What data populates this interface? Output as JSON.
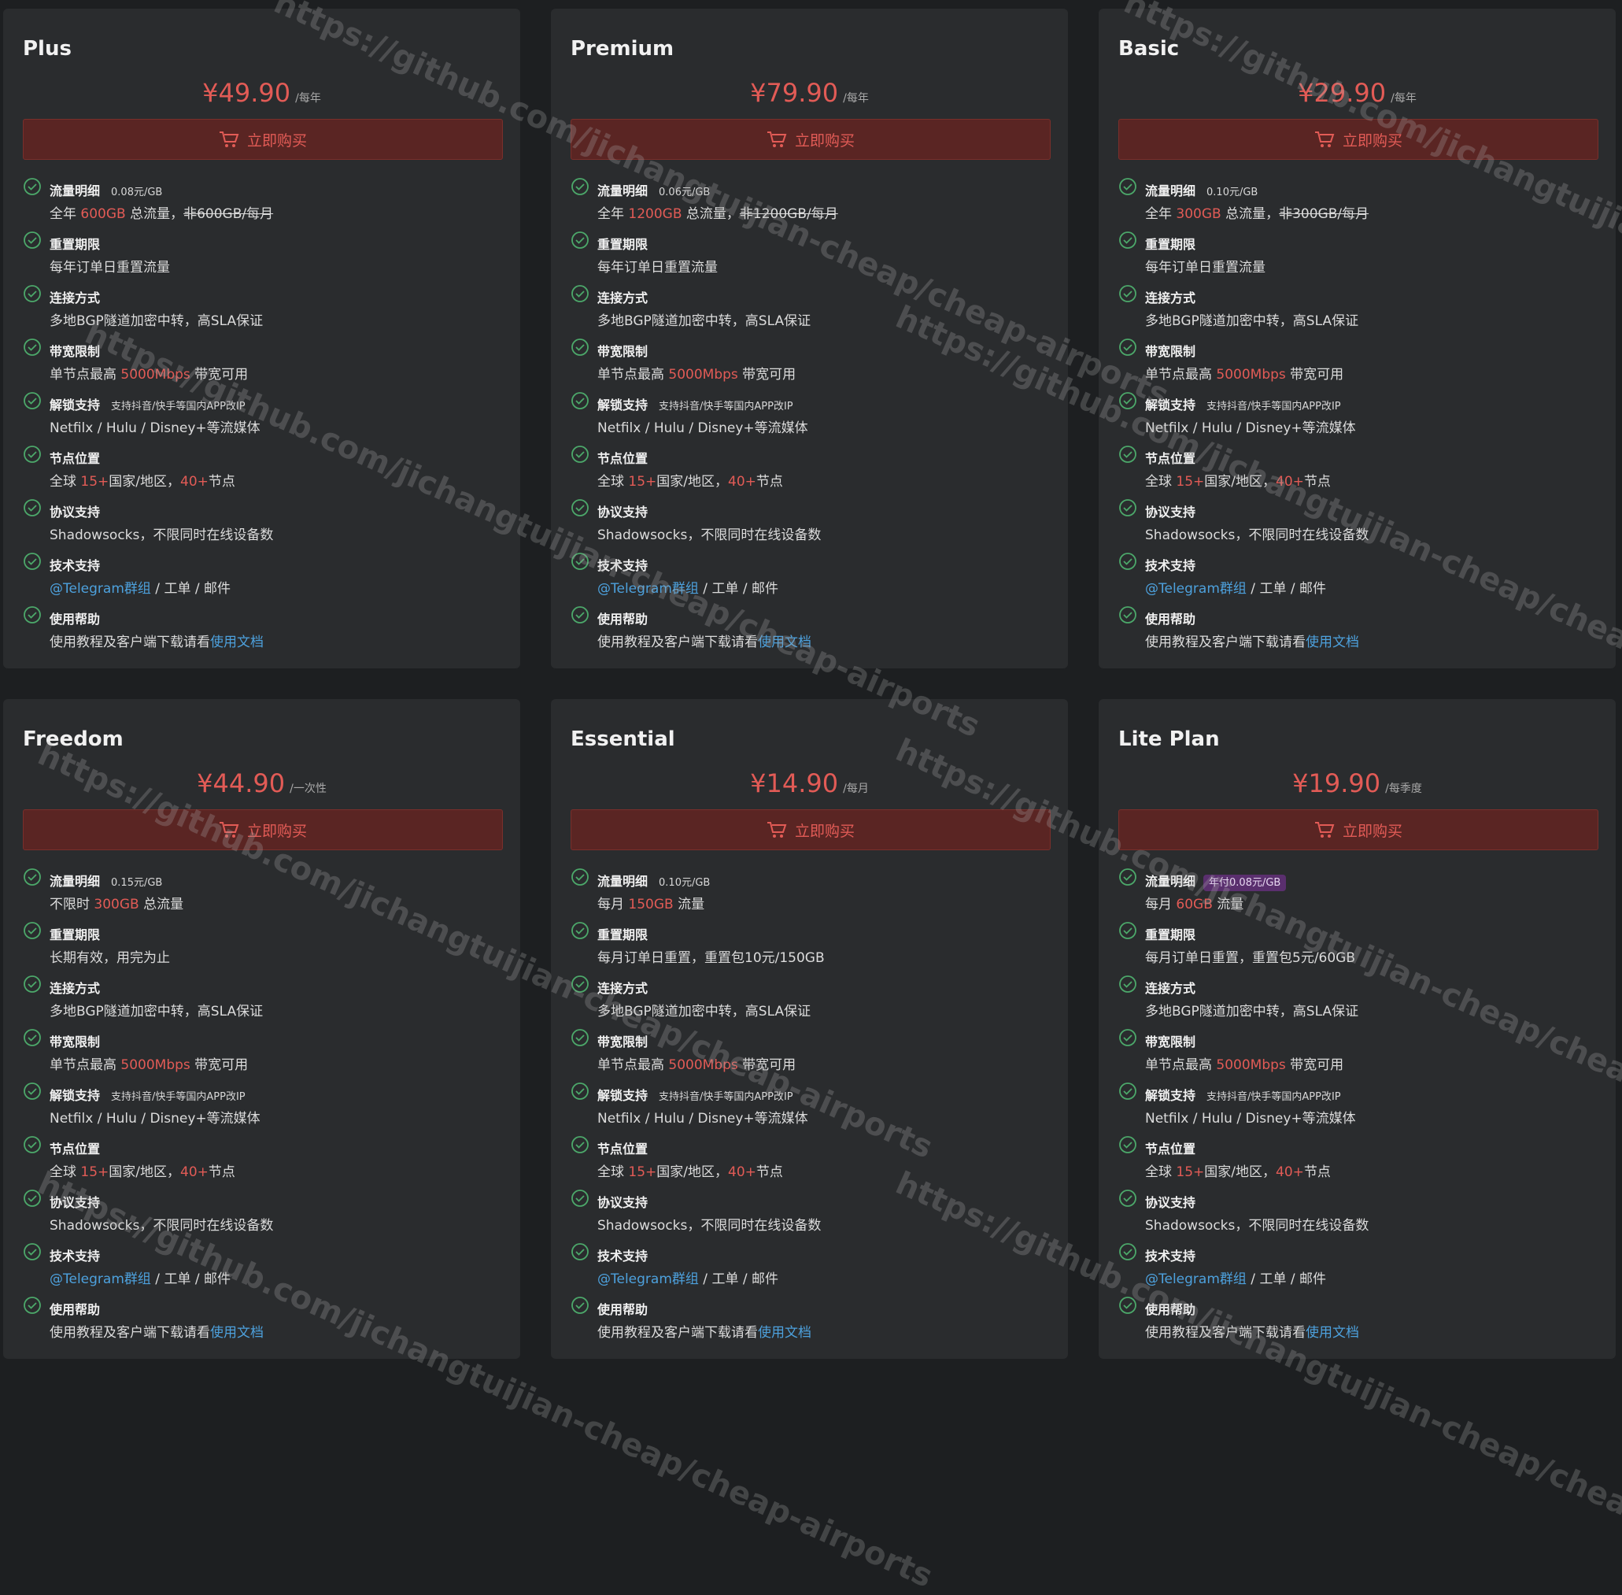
{
  "buy_label": "立即购买",
  "colors": {
    "accent": "#e25b56",
    "link": "#4da1dd",
    "check": "#4ca86a",
    "card_bg": "#2a2c2e"
  },
  "labels": {
    "traffic": "流量明细",
    "reset": "重置期限",
    "connection": "连接方式",
    "bandwidth": "带宽限制",
    "unlock": "解锁支持",
    "nodes": "节点位置",
    "protocol": "协议支持",
    "support": "技术支持",
    "help": "使用帮助"
  },
  "common": {
    "connection_desc": "多地BGP隧道加密中转，高SLA保证",
    "bandwidth_pre": "单节点最高 ",
    "bandwidth_hl": "5000Mbps",
    "bandwidth_post": " 带宽可用",
    "unlock_note": "支持抖音/快手等国内APP改IP",
    "unlock_desc": "Netfilx / Hulu / Disney+等流媒体",
    "nodes_pre": "全球 ",
    "nodes_hl1": "15+",
    "nodes_mid": "国家/地区，",
    "nodes_hl2": "40+",
    "nodes_post": "节点",
    "protocol_desc": "Shadowsocks，不限同时在线设备数",
    "support_link": "@Telegram群组",
    "support_post": " / 工单 / 邮件",
    "help_pre": "使用教程及客户端下载请看",
    "help_link": "使用文档"
  },
  "plans": [
    {
      "name": "Plus",
      "price": "¥49.90",
      "period": "/每年",
      "traffic_note": "0.08元/GB",
      "traffic_pre": "全年 ",
      "traffic_hl": "600GB",
      "traffic_mid": " 总流量，",
      "traffic_strike": "非600GB/每月",
      "reset_desc": "每年订单日重置流量"
    },
    {
      "name": "Premium",
      "price": "¥79.90",
      "period": "/每年",
      "traffic_note": "0.06元/GB",
      "traffic_pre": "全年 ",
      "traffic_hl": "1200GB",
      "traffic_mid": " 总流量，",
      "traffic_strike": "非1200GB/每月",
      "reset_desc": "每年订单日重置流量"
    },
    {
      "name": "Basic",
      "price": "¥29.90",
      "period": "/每年",
      "traffic_note": "0.10元/GB",
      "traffic_pre": "全年 ",
      "traffic_hl": "300GB",
      "traffic_mid": " 总流量，",
      "traffic_strike": "非300GB/每月",
      "reset_desc": "每年订单日重置流量"
    },
    {
      "name": "Freedom",
      "price": "¥44.90",
      "period": "/一次性",
      "traffic_note": "0.15元/GB",
      "traffic_pre": "不限时 ",
      "traffic_hl": "300GB",
      "traffic_mid": " 总流量",
      "traffic_strike": "",
      "reset_desc": "长期有效，用完为止"
    },
    {
      "name": "Essential",
      "price": "¥14.90",
      "period": "/每月",
      "traffic_note": "0.10元/GB",
      "traffic_pre": "每月 ",
      "traffic_hl": "150GB",
      "traffic_mid": " 流量",
      "traffic_strike": "",
      "reset_desc": "每月订单日重置，重置包10元/150GB"
    },
    {
      "name": "Lite Plan",
      "price": "¥19.90",
      "period": "/每季度",
      "traffic_note": "年付0.08元/GB",
      "traffic_pre": "每月 ",
      "traffic_hl": "60GB",
      "traffic_mid": " 流量",
      "traffic_strike": "",
      "reset_desc": "每月订单日重置，重置包5元/60GB"
    }
  ],
  "watermark_text": "https://github.com/jichangtuijian-cheap/cheap-airports"
}
